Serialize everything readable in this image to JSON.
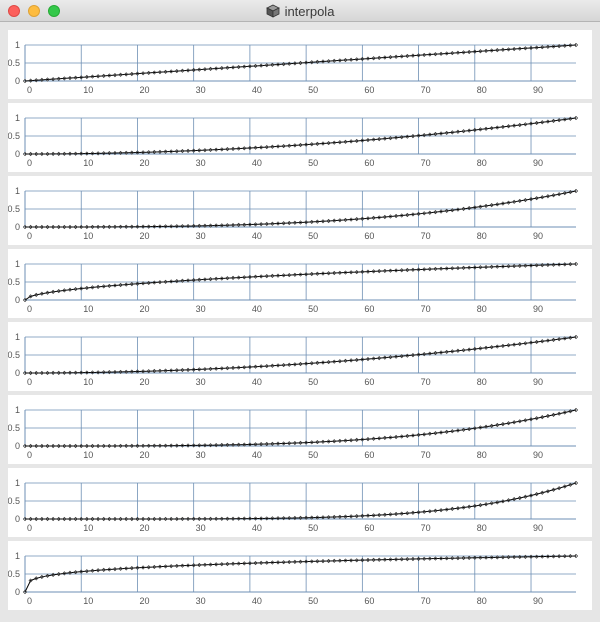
{
  "window": {
    "title": "interpola",
    "app_icon": "cube-icon",
    "buttons": [
      "close-icon",
      "minimize-icon",
      "zoom-icon"
    ]
  },
  "colors": {
    "curve": "#000000",
    "grid": "#6e8fb4",
    "tick_label": "#555555",
    "panel_bg": "#ffffff",
    "window_bg": "#e6e6e6"
  },
  "chart_data": [
    {
      "type": "line",
      "function": "pow",
      "exponent": 1.0,
      "x": {
        "start": 0,
        "end": 98,
        "step": 1
      },
      "xlim": [
        0,
        98
      ],
      "ylim": [
        0,
        1
      ],
      "xticks": [
        0,
        10,
        20,
        30,
        40,
        50,
        60,
        70,
        80,
        90
      ],
      "yticks": [
        0,
        0.5,
        1
      ],
      "ytick_labels": [
        "0",
        "0.5",
        "1"
      ],
      "grid": true,
      "markers": "diamond"
    },
    {
      "type": "line",
      "function": "pow",
      "exponent": 2.0,
      "x": {
        "start": 0,
        "end": 98,
        "step": 1
      },
      "xlim": [
        0,
        98
      ],
      "ylim": [
        0,
        1
      ],
      "xticks": [
        0,
        10,
        20,
        30,
        40,
        50,
        60,
        70,
        80,
        90
      ],
      "yticks": [
        0,
        0.5,
        1
      ],
      "ytick_labels": [
        "0",
        "0.5",
        "1"
      ],
      "grid": true,
      "markers": "diamond"
    },
    {
      "type": "line",
      "function": "pow",
      "exponent": 3.0,
      "x": {
        "start": 0,
        "end": 98,
        "step": 1
      },
      "xlim": [
        0,
        98
      ],
      "ylim": [
        0,
        1
      ],
      "xticks": [
        0,
        10,
        20,
        30,
        40,
        50,
        60,
        70,
        80,
        90
      ],
      "yticks": [
        0,
        0.5,
        1
      ],
      "ytick_labels": [
        "0",
        "0.5",
        "1"
      ],
      "grid": true,
      "markers": "diamond"
    },
    {
      "type": "line",
      "function": "pow",
      "exponent": 0.5,
      "x": {
        "start": 0,
        "end": 98,
        "step": 1
      },
      "xlim": [
        0,
        98
      ],
      "ylim": [
        0,
        1
      ],
      "xticks": [
        0,
        10,
        20,
        30,
        40,
        50,
        60,
        70,
        80,
        90
      ],
      "yticks": [
        0,
        0.5,
        1
      ],
      "ytick_labels": [
        "0",
        "0.5",
        "1"
      ],
      "grid": true,
      "markers": "diamond"
    },
    {
      "type": "line",
      "function": "pow",
      "exponent": 2.0,
      "x": {
        "start": 0,
        "end": 98,
        "step": 1
      },
      "xlim": [
        0,
        98
      ],
      "ylim": [
        0,
        1
      ],
      "xticks": [
        0,
        10,
        20,
        30,
        40,
        50,
        60,
        70,
        80,
        90
      ],
      "yticks": [
        0,
        0.5,
        1
      ],
      "ytick_labels": [
        "0",
        "0.5",
        "1"
      ],
      "grid": true,
      "markers": "diamond"
    },
    {
      "type": "line",
      "function": "pow",
      "exponent": 3.5,
      "x": {
        "start": 0,
        "end": 98,
        "step": 1
      },
      "xlim": [
        0,
        98
      ],
      "ylim": [
        0,
        1
      ],
      "xticks": [
        0,
        10,
        20,
        30,
        40,
        50,
        60,
        70,
        80,
        90
      ],
      "yticks": [
        0,
        0.5,
        1
      ],
      "ytick_labels": [
        "0",
        "0.5",
        "1"
      ],
      "grid": true,
      "markers": "diamond"
    },
    {
      "type": "line",
      "function": "pow",
      "exponent": 5.0,
      "x": {
        "start": 0,
        "end": 98,
        "step": 1
      },
      "xlim": [
        0,
        98
      ],
      "ylim": [
        0,
        1
      ],
      "xticks": [
        0,
        10,
        20,
        30,
        40,
        50,
        60,
        70,
        80,
        90
      ],
      "yticks": [
        0,
        0.5,
        1
      ],
      "ytick_labels": [
        "0",
        "0.5",
        "1"
      ],
      "grid": true,
      "markers": "diamond"
    },
    {
      "type": "line",
      "function": "pow",
      "exponent": 0.25,
      "x": {
        "start": 0,
        "end": 98,
        "step": 1
      },
      "xlim": [
        0,
        98
      ],
      "ylim": [
        0,
        1
      ],
      "xticks": [
        0,
        10,
        20,
        30,
        40,
        50,
        60,
        70,
        80,
        90
      ],
      "yticks": [
        0,
        0.5,
        1
      ],
      "ytick_labels": [
        "0",
        "0.5",
        "1"
      ],
      "grid": true,
      "markers": "diamond"
    }
  ]
}
